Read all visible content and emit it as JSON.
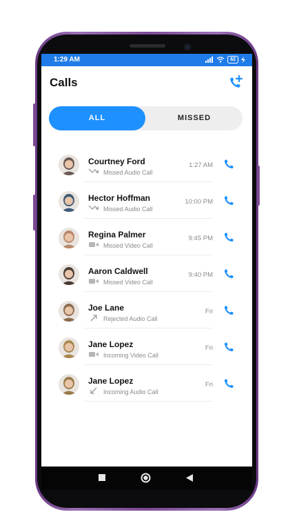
{
  "status": {
    "time": "1:29 AM",
    "battery": "62"
  },
  "header": {
    "title": "Calls",
    "add_call_icon": "add-call-icon"
  },
  "tabs": [
    {
      "label": "ALL",
      "active": true
    },
    {
      "label": "MISSED",
      "active": false
    }
  ],
  "calls": [
    {
      "name": "Courtney Ford",
      "type": "Missed Audio Call",
      "icon": "missed-call-icon",
      "time": "1:27 AM",
      "avatar_color": "#6b5a55"
    },
    {
      "name": "Hector Hoffman",
      "type": "Missed Audio Call",
      "icon": "missed-call-icon",
      "time": "10:00 PM",
      "avatar_color": "#3e5a7a"
    },
    {
      "name": "Regina Palmer",
      "type": "Missed Video Call",
      "icon": "video-icon",
      "time": "9:45 PM",
      "avatar_color": "#b88a6a"
    },
    {
      "name": "Aaron Caldwell",
      "type": "Missed Video Call",
      "icon": "video-icon",
      "time": "9:40 PM",
      "avatar_color": "#4a3b35"
    },
    {
      "name": "Joe Lane",
      "type": "Rejected Audio Call",
      "icon": "outgoing-call-icon",
      "time": "Fri",
      "avatar_color": "#8b6b4e"
    },
    {
      "name": "Jane Lopez",
      "type": "Incoming Video Call",
      "icon": "video-icon",
      "time": "Fri",
      "avatar_color": "#a8874f"
    },
    {
      "name": "Jane Lopez",
      "type": "Incoming Audio Call",
      "icon": "incoming-call-icon",
      "time": "Fri",
      "avatar_color": "#9a7b4a"
    }
  ],
  "colors": {
    "accent": "#1e90ff",
    "statusbar": "#1f7be8",
    "phone_frame": "#7d4a98"
  }
}
